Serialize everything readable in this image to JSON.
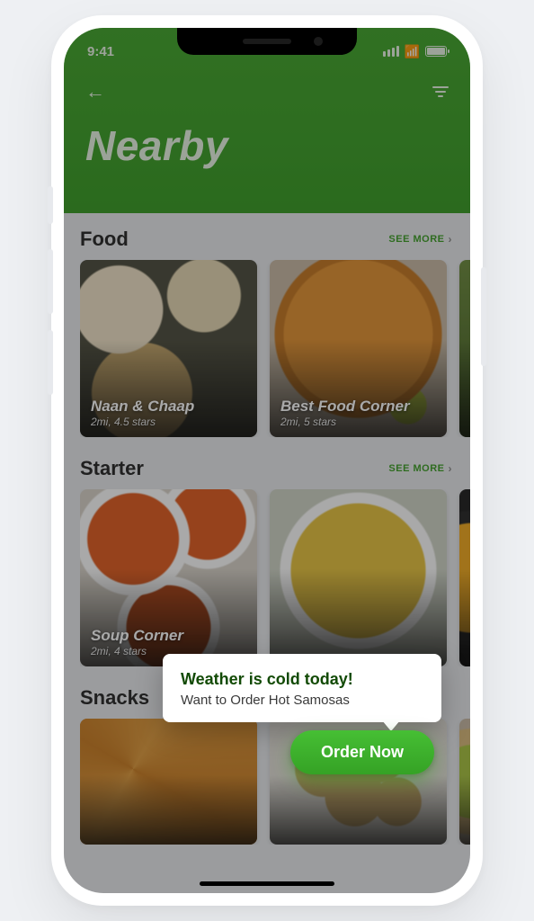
{
  "status": {
    "time": "9:41"
  },
  "header": {
    "title": "Nearby"
  },
  "see_more_label": "SEE MORE",
  "sections": [
    {
      "title": "Food",
      "cards": [
        {
          "name": "Naan & Chaap",
          "meta": "2mi, 4.5 stars"
        },
        {
          "name": "Best Food Corner",
          "meta": "2mi, 5 stars"
        }
      ]
    },
    {
      "title": "Starter",
      "cards": [
        {
          "name": "Soup Corner",
          "meta": "2mi, 4 stars"
        }
      ]
    },
    {
      "title": "Snacks",
      "cards": []
    }
  ],
  "popover": {
    "title": "Weather is cold today!",
    "body": "Want to Order Hot Samosas"
  },
  "cta": {
    "label": "Order Now"
  }
}
